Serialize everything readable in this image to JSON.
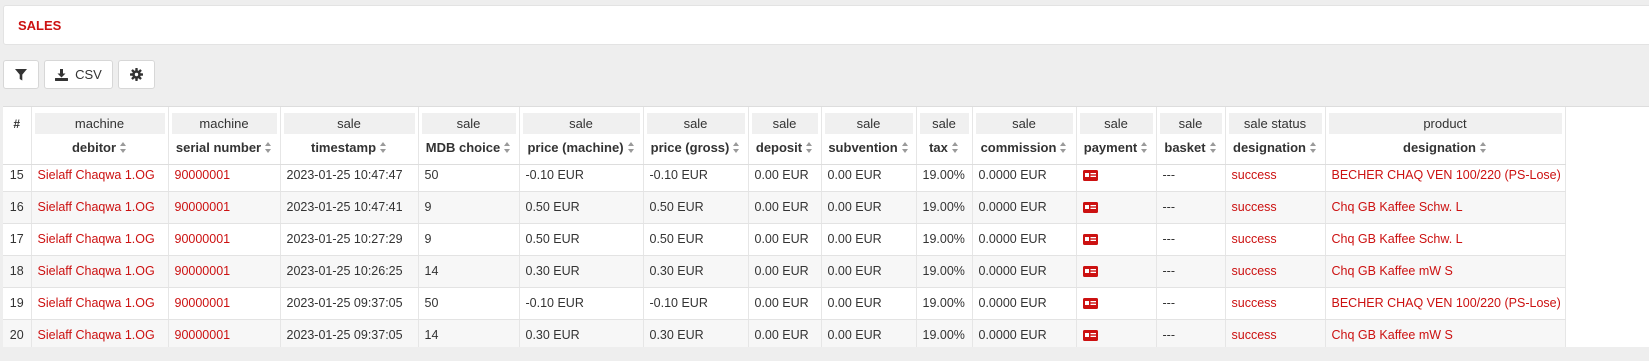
{
  "page": {
    "title": "SALES"
  },
  "toolbar": {
    "csv_label": "CSV"
  },
  "columns": [
    {
      "group": "",
      "label": "#"
    },
    {
      "group": "machine",
      "label": "debitor"
    },
    {
      "group": "machine",
      "label": "serial number"
    },
    {
      "group": "sale",
      "label": "timestamp"
    },
    {
      "group": "sale",
      "label": "MDB choice"
    },
    {
      "group": "sale",
      "label": "price (machine)"
    },
    {
      "group": "sale",
      "label": "price (gross)"
    },
    {
      "group": "sale",
      "label": "deposit"
    },
    {
      "group": "sale",
      "label": "subvention"
    },
    {
      "group": "sale",
      "label": "tax"
    },
    {
      "group": "sale",
      "label": "commission"
    },
    {
      "group": "sale",
      "label": "payment"
    },
    {
      "group": "sale",
      "label": "basket"
    },
    {
      "group": "sale status",
      "label": "designation"
    },
    {
      "group": "product",
      "label": "designation"
    }
  ],
  "partial_row": {
    "num": "15",
    "debitor": "Sielaff Chaqwa 1.OG",
    "serial": "90000001",
    "timestamp": "2023-01-25 10:47:47",
    "mdb": "50",
    "price_machine": "-0.10 EUR",
    "price_gross": "-0.10 EUR",
    "deposit": "0.00 EUR",
    "subvention": "0.00 EUR",
    "tax": "19.00%",
    "commission": "0.0000 EUR",
    "basket": "---",
    "status": "success",
    "product": "BECHER CHAQ VEN 100/220 (PS-Lose)"
  },
  "rows": [
    {
      "num": "16",
      "debitor": "Sielaff Chaqwa 1.OG",
      "serial": "90000001",
      "timestamp": "2023-01-25 10:47:41",
      "mdb": "9",
      "price_machine": "0.50 EUR",
      "price_gross": "0.50 EUR",
      "deposit": "0.00 EUR",
      "subvention": "0.00 EUR",
      "tax": "19.00%",
      "commission": "0.0000 EUR",
      "payment_icon": "card-payment-icon",
      "basket": "---",
      "status": "success",
      "product": "Chq GB Kaffee Schw. L"
    },
    {
      "num": "17",
      "debitor": "Sielaff Chaqwa 1.OG",
      "serial": "90000001",
      "timestamp": "2023-01-25 10:27:29",
      "mdb": "9",
      "price_machine": "0.50 EUR",
      "price_gross": "0.50 EUR",
      "deposit": "0.00 EUR",
      "subvention": "0.00 EUR",
      "tax": "19.00%",
      "commission": "0.0000 EUR",
      "payment_icon": "card-payment-icon",
      "basket": "---",
      "status": "success",
      "product": "Chq GB Kaffee Schw. L"
    },
    {
      "num": "18",
      "debitor": "Sielaff Chaqwa 1.OG",
      "serial": "90000001",
      "timestamp": "2023-01-25 10:26:25",
      "mdb": "14",
      "price_machine": "0.30 EUR",
      "price_gross": "0.30 EUR",
      "deposit": "0.00 EUR",
      "subvention": "0.00 EUR",
      "tax": "19.00%",
      "commission": "0.0000 EUR",
      "payment_icon": "card-payment-icon",
      "basket": "---",
      "status": "success",
      "product": "Chq GB Kaffee mW S"
    },
    {
      "num": "19",
      "debitor": "Sielaff Chaqwa 1.OG",
      "serial": "90000001",
      "timestamp": "2023-01-25 09:37:05",
      "mdb": "50",
      "price_machine": "-0.10 EUR",
      "price_gross": "-0.10 EUR",
      "deposit": "0.00 EUR",
      "subvention": "0.00 EUR",
      "tax": "19.00%",
      "commission": "0.0000 EUR",
      "payment_icon": "card-payment-icon",
      "basket": "---",
      "status": "success",
      "product": "BECHER CHAQ VEN 100/220 (PS-Lose)"
    },
    {
      "num": "20",
      "debitor": "Sielaff Chaqwa 1.OG",
      "serial": "90000001",
      "timestamp": "2023-01-25 09:37:05",
      "mdb": "14",
      "price_machine": "0.30 EUR",
      "price_gross": "0.30 EUR",
      "deposit": "0.00 EUR",
      "subvention": "0.00 EUR",
      "tax": "19.00%",
      "commission": "0.0000 EUR",
      "payment_icon": "card-payment-icon",
      "basket": "---",
      "status": "success",
      "product": "Chq GB Kaffee mW S"
    }
  ],
  "colors": {
    "accent": "#cc1111",
    "header_group_bg": "#f0f0f0",
    "page_bg": "#eeeeee"
  }
}
